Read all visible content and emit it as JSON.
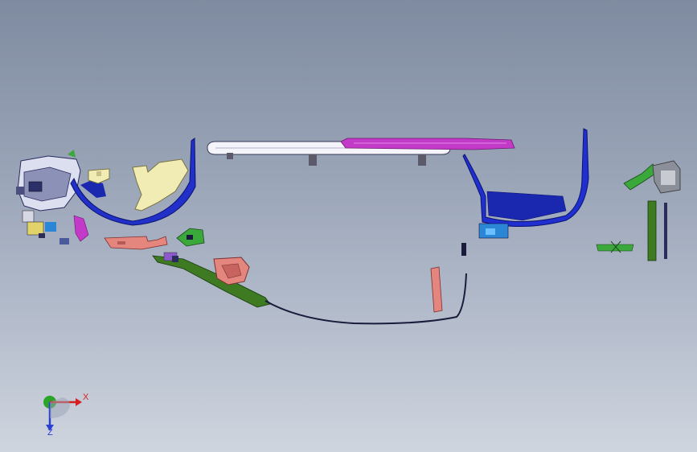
{
  "viewport": {
    "background_top": "#7f8ba0",
    "background_bottom": "#cfd5de"
  },
  "triad": {
    "x_label": "X",
    "z_label": "Z",
    "x_color": "#d42020",
    "y_color": "#2aa52a",
    "z_color": "#2b3fd0"
  },
  "colors": {
    "blue_part": "#1f2fd0",
    "yellow_part": "#f1ecb4",
    "white_part": "#f4f4fa",
    "magenta_part": "#c43ac8",
    "salmon_part": "#e4867e",
    "green_part": "#3aa83a",
    "olive_part": "#3d7a22",
    "dark_line": "#1a1a3a",
    "gray_part": "#8b8f99"
  }
}
